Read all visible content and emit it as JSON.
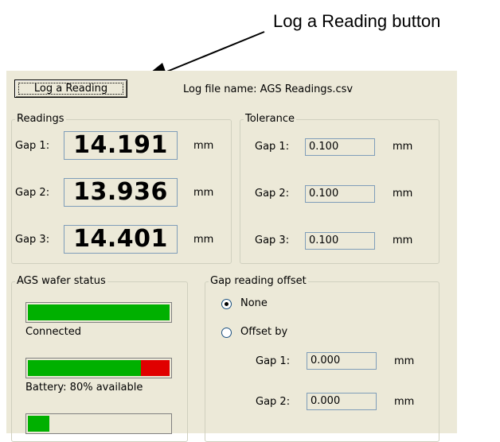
{
  "callout": {
    "text": "Log a Reading button"
  },
  "toolbar": {
    "log_button_label": "Log a Reading",
    "log_file_label": "Log file name:",
    "log_file_name": "AGS Readings.csv"
  },
  "readings": {
    "title": "Readings",
    "unit": "mm",
    "rows": [
      {
        "label": "Gap 1:",
        "value": "14.191"
      },
      {
        "label": "Gap 2:",
        "value": "13.936"
      },
      {
        "label": "Gap 3:",
        "value": "14.401"
      }
    ]
  },
  "tolerance": {
    "title": "Tolerance",
    "unit": "mm",
    "rows": [
      {
        "label": "Gap 1:",
        "value": "0.100"
      },
      {
        "label": "Gap 2:",
        "value": "0.100"
      },
      {
        "label": "Gap 3:",
        "value": "0.100"
      }
    ]
  },
  "wafer_status": {
    "title": "AGS wafer status",
    "connection": {
      "label": "Connected",
      "level": 1.0,
      "color": "#00b000"
    },
    "battery": {
      "label": "Battery: 80% available",
      "level": 0.8,
      "fill_color": "#00b000",
      "empty_color": "#e00000"
    },
    "third": {
      "level": 0.15,
      "color": "#00b000"
    }
  },
  "offset": {
    "title": "Gap reading offset",
    "options": [
      {
        "label": "None",
        "selected": true
      },
      {
        "label": "Offset by",
        "selected": false
      }
    ],
    "unit": "mm",
    "rows": [
      {
        "label": "Gap 1:",
        "value": "0.000"
      },
      {
        "label": "Gap 2:",
        "value": "0.000"
      }
    ]
  }
}
